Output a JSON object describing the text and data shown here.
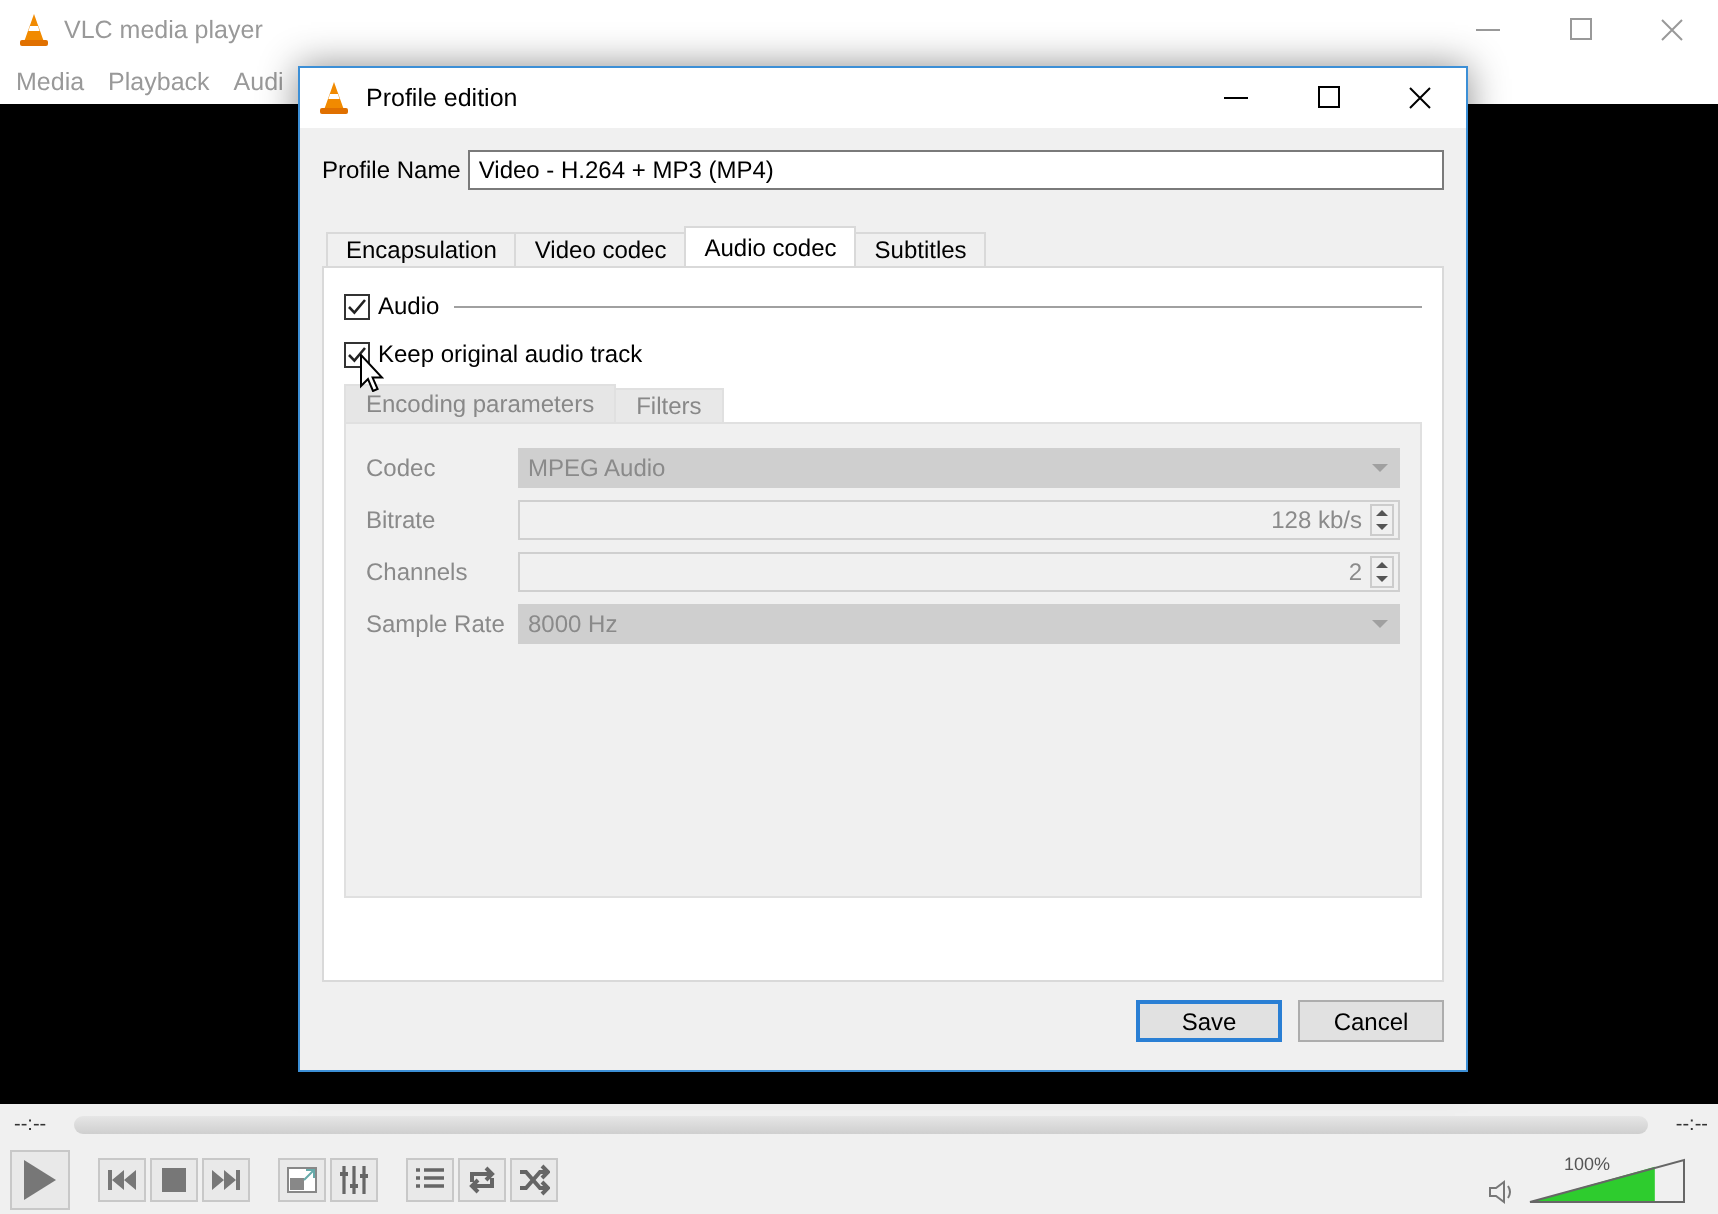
{
  "main_window": {
    "title": "VLC media player",
    "menu": [
      "Media",
      "Playback",
      "Audi"
    ]
  },
  "dialog": {
    "title": "Profile edition",
    "profile_name": {
      "label": "Profile Name",
      "value": "Video - H.264 + MP3 (MP4)"
    },
    "tabs": [
      {
        "label": "Encapsulation",
        "selected": false
      },
      {
        "label": "Video codec",
        "selected": false
      },
      {
        "label": "Audio codec",
        "selected": true
      },
      {
        "label": "Subtitles",
        "selected": false
      }
    ],
    "audio": {
      "label": "Audio",
      "checked": true
    },
    "keep_original": {
      "label": "Keep original audio track",
      "checked": true
    },
    "sub_tabs": [
      {
        "label": "Encoding parameters",
        "selected": true
      },
      {
        "label": "Filters",
        "selected": false
      }
    ],
    "fields": [
      {
        "label": "Codec",
        "kind": "combo",
        "value": "MPEG Audio",
        "disabled": true
      },
      {
        "label": "Bitrate",
        "kind": "spin",
        "value": "128 kb/s",
        "disabled": true
      },
      {
        "label": "Channels",
        "kind": "spin",
        "value": "2",
        "disabled": true
      },
      {
        "label": "Sample Rate",
        "kind": "combo",
        "value": "8000 Hz",
        "disabled": true
      }
    ],
    "buttons": [
      {
        "label": "Save",
        "default": true
      },
      {
        "label": "Cancel",
        "default": false
      }
    ]
  },
  "player": {
    "elapsed": "--:--",
    "remaining": "--:--",
    "controls": [
      {
        "kind": "play"
      },
      {
        "kind": "previous"
      },
      {
        "kind": "stop"
      },
      {
        "kind": "next"
      },
      {
        "kind": "fullscreen"
      },
      {
        "kind": "extended"
      },
      {
        "kind": "playlist"
      },
      {
        "kind": "loop"
      },
      {
        "kind": "random"
      }
    ],
    "volume": {
      "reading": "100%",
      "level": 0.8
    }
  }
}
